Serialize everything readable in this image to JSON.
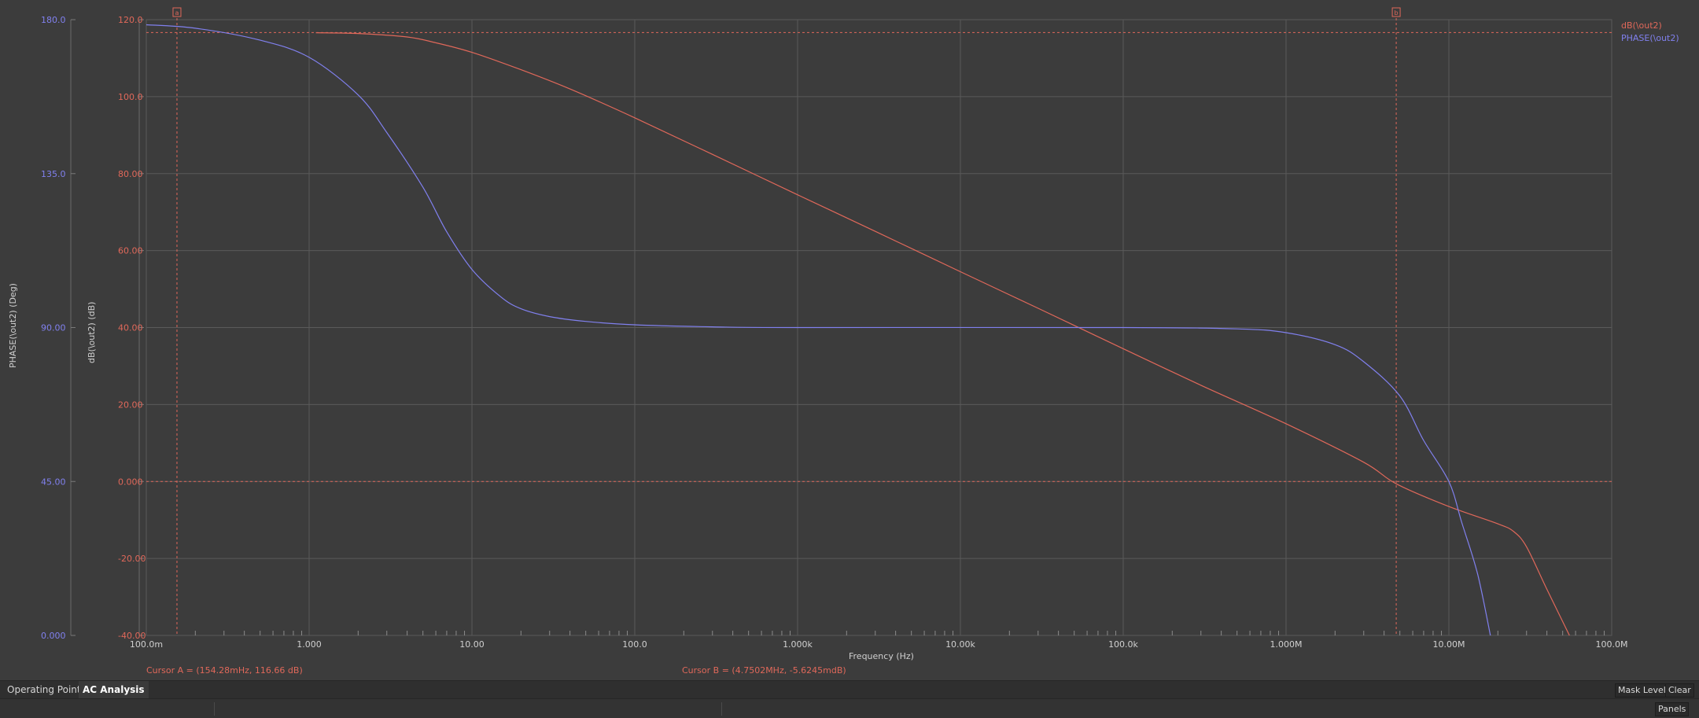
{
  "chart_data": {
    "type": "line",
    "xlabel": "Frequency (Hz)",
    "x_scale": "log",
    "xlim": [
      0.1,
      100000000
    ],
    "x_ticks": [
      {
        "value": 0.1,
        "label": "100.0m"
      },
      {
        "value": 1,
        "label": "1.000"
      },
      {
        "value": 10,
        "label": "10.00"
      },
      {
        "value": 100,
        "label": "100.0"
      },
      {
        "value": 1000,
        "label": "1.000k"
      },
      {
        "value": 10000,
        "label": "10.00k"
      },
      {
        "value": 100000,
        "label": "100.0k"
      },
      {
        "value": 1000000,
        "label": "1.000M"
      },
      {
        "value": 10000000,
        "label": "10.00M"
      },
      {
        "value": 100000000,
        "label": "100.0M"
      }
    ],
    "y_axes": [
      {
        "id": "db",
        "label": "dB(\\out2) (dB)",
        "ylim": [
          -40,
          120
        ],
        "ticks": [
          {
            "value": 120,
            "label": "120.0"
          },
          {
            "value": 100,
            "label": "100.0"
          },
          {
            "value": 80,
            "label": "80.00"
          },
          {
            "value": 60,
            "label": "60.00"
          },
          {
            "value": 40,
            "label": "40.00"
          },
          {
            "value": 20,
            "label": "20.00"
          },
          {
            "value": 0,
            "label": "0.000"
          },
          {
            "value": -20,
            "label": "-20.00"
          },
          {
            "value": -40,
            "label": "-40.00"
          }
        ],
        "color": "#e0685a"
      },
      {
        "id": "phase",
        "label": "PHASE(\\out2) (Deg)",
        "ylim": [
          0,
          180
        ],
        "ticks": [
          {
            "value": 180,
            "label": "180.0"
          },
          {
            "value": 135,
            "label": "135.0"
          },
          {
            "value": 90,
            "label": "90.00"
          },
          {
            "value": 45,
            "label": "45.00"
          },
          {
            "value": 0,
            "label": "0.000"
          }
        ],
        "color": "#8080ee"
      }
    ],
    "grid": true,
    "legend_position": "top-right",
    "series": [
      {
        "name": "dB(\\out2)",
        "axis": "db",
        "color": "#e0685a",
        "points": [
          [
            1.1,
            116.6
          ],
          [
            2,
            116.4
          ],
          [
            4,
            115.5
          ],
          [
            6,
            114
          ],
          [
            10,
            111.5
          ],
          [
            20,
            107
          ],
          [
            40,
            102
          ],
          [
            100,
            94.5
          ],
          [
            300,
            85
          ],
          [
            1000,
            74.5
          ],
          [
            3000,
            65
          ],
          [
            10000,
            54.5
          ],
          [
            30000,
            45
          ],
          [
            100000,
            34.5
          ],
          [
            300000,
            25
          ],
          [
            1000000,
            15
          ],
          [
            3000000,
            5
          ],
          [
            4750200,
            -0.6
          ],
          [
            10000000,
            -6.5
          ],
          [
            20000000,
            -11
          ],
          [
            25000000,
            -13
          ],
          [
            30000000,
            -17
          ],
          [
            40000000,
            -28
          ],
          [
            55000000,
            -40
          ]
        ]
      },
      {
        "name": "PHASE(\\out2)",
        "axis": "phase",
        "color": "#8080ee",
        "points": [
          [
            0.1,
            178.5
          ],
          [
            0.2,
            177.5
          ],
          [
            0.5,
            174
          ],
          [
            1,
            169
          ],
          [
            2,
            158
          ],
          [
            3,
            147
          ],
          [
            5,
            131
          ],
          [
            7,
            118
          ],
          [
            10,
            107
          ],
          [
            15,
            99
          ],
          [
            20,
            95.5
          ],
          [
            30,
            93.2
          ],
          [
            50,
            91.8
          ],
          [
            100,
            90.8
          ],
          [
            300,
            90.2
          ],
          [
            1000,
            90
          ],
          [
            100000,
            90
          ],
          [
            500000,
            89.6
          ],
          [
            1000000,
            88.5
          ],
          [
            2000000,
            85
          ],
          [
            3000000,
            80
          ],
          [
            5000000,
            70
          ],
          [
            7000000,
            57
          ],
          [
            10000000,
            45
          ],
          [
            12000000,
            33
          ],
          [
            15000000,
            18
          ],
          [
            18000000,
            0
          ]
        ]
      }
    ],
    "cursors": [
      {
        "id": "A",
        "x": 0.15428,
        "marker": "a",
        "readout": "Cursor A = (154.28mHz, 116.66 dB)"
      },
      {
        "id": "B",
        "x": 4750200,
        "marker": "b",
        "readout": "Cursor B = (4.7502MHz, -5.6245mdB)"
      }
    ],
    "reference_lines": [
      {
        "axis": "db",
        "y": 116.66
      },
      {
        "axis": "db",
        "y": 0
      }
    ],
    "colors": {
      "background": "#3c3c3c",
      "grid": "#5a5a5a",
      "cursor": "#e0685a",
      "db_series": "#e0685a",
      "phase_series": "#8080ee"
    }
  },
  "bottom_tabs": [
    {
      "label": "Operating Point",
      "active": false
    },
    {
      "label": "AC Analysis",
      "active": true
    }
  ],
  "toolbar": {
    "mask_level_label": "Mask Level",
    "clear_label": "Clear"
  },
  "status": {
    "panels_label": "Panels"
  }
}
